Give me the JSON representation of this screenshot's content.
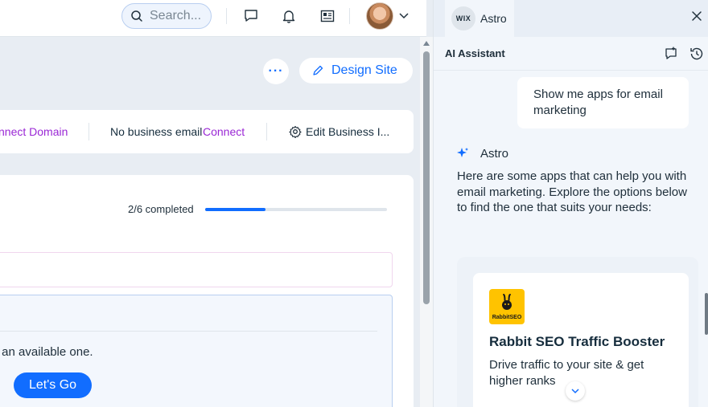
{
  "header": {
    "search_placeholder": "Search...",
    "icons": [
      "search-icon",
      "chat-icon",
      "bell-icon",
      "news-icon",
      "avatar",
      "chevron-down-icon"
    ]
  },
  "main": {
    "design_site_label": "Design Site",
    "more_label": "···",
    "domain_bar": {
      "connect_domain": "nnect Domain",
      "business_email_label": "No business email",
      "connect_label": "Connect",
      "edit_business_label": "Edit Business I..."
    },
    "setup": {
      "progress_label": "2/6 completed",
      "progress_fraction": 0.33,
      "task_text": "r an available one.",
      "go_label": "Let's Go"
    }
  },
  "assistant": {
    "tab_badge": "WIX",
    "tab_label": "Astro",
    "title": "AI Assistant",
    "user_message": "Show me apps for email marketing",
    "bot_name": "Astro",
    "bot_message": "Here are some apps that can help you with email marketing. Explore the options below to find the one that suits your needs:",
    "app": {
      "logo_text": "RabbitSEO",
      "name": "Rabbit SEO Traffic Booster",
      "description": "Drive traffic to your site & get higher ranks"
    }
  },
  "colors": {
    "accent": "#116dff",
    "purple_link": "#9a27d5",
    "logo_yellow": "#ffc300"
  }
}
